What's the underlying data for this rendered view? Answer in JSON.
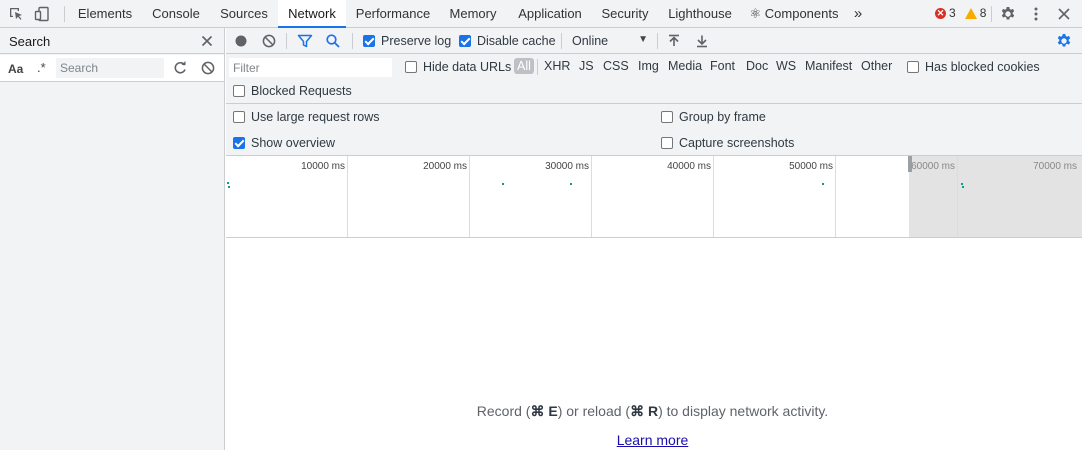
{
  "tabs": [
    {
      "label": "Elements",
      "active": false
    },
    {
      "label": "Console",
      "active": false
    },
    {
      "label": "Sources",
      "active": false
    },
    {
      "label": "Network",
      "active": true
    },
    {
      "label": "Performance",
      "active": false
    },
    {
      "label": "Memory",
      "active": false
    },
    {
      "label": "Application",
      "active": false
    },
    {
      "label": "Security",
      "active": false
    },
    {
      "label": "Lighthouse",
      "active": false
    },
    {
      "label": "⚛ Components",
      "active": false
    }
  ],
  "more_tabs": "»",
  "counts": {
    "errors": "3",
    "warnings": "8"
  },
  "sidebar": {
    "title": "Search",
    "match_case": "Aa",
    "regex": ".*",
    "placeholder": "Search"
  },
  "toolbar": {
    "preserve_log": {
      "label": "Preserve log",
      "checked": true
    },
    "disable_cache": {
      "label": "Disable cache",
      "checked": true
    },
    "throttling": "Online"
  },
  "filter": {
    "placeholder": "Filter",
    "hide_data_urls": "Hide data URLs",
    "types": [
      "All",
      "XHR",
      "JS",
      "CSS",
      "Img",
      "Media",
      "Font",
      "Doc",
      "WS",
      "Manifest",
      "Other"
    ],
    "active_type": "All",
    "has_blocked_cookies": "Has blocked cookies",
    "blocked_requests": "Blocked Requests"
  },
  "settings": {
    "large_rows": {
      "label": "Use large request rows",
      "checked": false
    },
    "group_by_frame": {
      "label": "Group by frame",
      "checked": false
    },
    "show_overview": {
      "label": "Show overview",
      "checked": true
    },
    "capture_screenshots": {
      "label": "Capture screenshots",
      "checked": false
    }
  },
  "overview": {
    "ticks": [
      "10000 ms",
      "20000 ms",
      "30000 ms",
      "40000 ms",
      "50000 ms",
      "60000 ms",
      "70000 ms"
    ]
  },
  "empty": {
    "record_pre": "Record (",
    "record_key": "⌘ E",
    "record_mid": ") or reload (",
    "reload_key": "⌘ R",
    "record_post": ") to display network activity.",
    "learn_more": "Learn more"
  },
  "colors": {
    "accent": "#1a73e8",
    "error": "#d93025",
    "warning": "#f9ab00"
  }
}
